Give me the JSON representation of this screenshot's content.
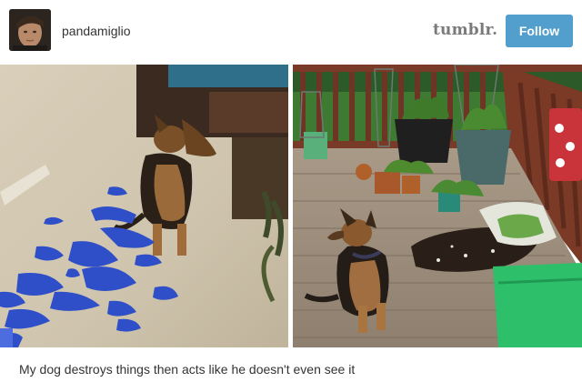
{
  "post": {
    "username": "pandamiglio",
    "brand": "tumblr.",
    "follow_label": "Follow",
    "caption": "My dog destroys things then acts like he doesn't even see it"
  },
  "colors": {
    "follow_button": "#529ecc",
    "brand_text": "#7a7a7a",
    "background": "#ffffff"
  },
  "icons": {
    "avatar": "profile-photo"
  }
}
